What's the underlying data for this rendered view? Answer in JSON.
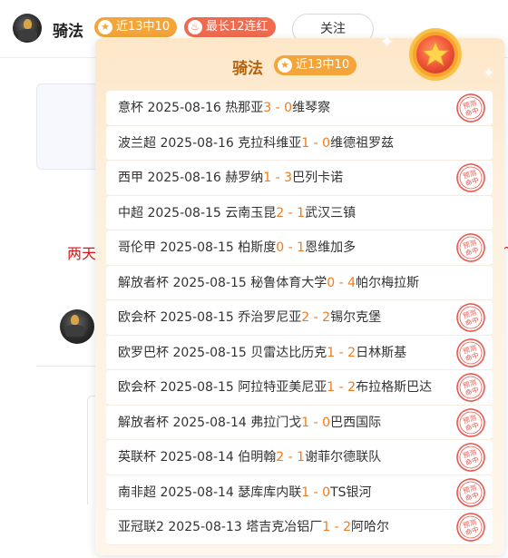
{
  "header": {
    "username": "骑法",
    "streak_badge": "近13中10",
    "max_badge": "最长12连红",
    "follow_label": "关注"
  },
  "background": {
    "text_left": "两天",
    "text_right": "h"
  },
  "popup": {
    "title": "骑法",
    "badge": "近13中10",
    "stamp_text": "预测命中",
    "matches": [
      {
        "league": "意杯",
        "date": "2025-08-16",
        "home": "热那亚",
        "home_score": "3",
        "away_score": "0",
        "away": "维琴察",
        "hit": true
      },
      {
        "league": "波兰超",
        "date": "2025-08-16",
        "home": "克拉科维亚",
        "home_score": "1",
        "away_score": "0",
        "away": "维德祖罗兹",
        "hit": false
      },
      {
        "league": "西甲",
        "date": "2025-08-16",
        "home": "赫罗纳",
        "home_score": "1",
        "away_score": "3",
        "away": "巴列卡诺",
        "hit": true
      },
      {
        "league": "中超",
        "date": "2025-08-15",
        "home": "云南玉昆",
        "home_score": "2",
        "away_score": "1",
        "away": "武汉三镇",
        "hit": false
      },
      {
        "league": "哥伦甲",
        "date": "2025-08-15",
        "home": "柏斯度",
        "home_score": "0",
        "away_score": "1",
        "away": "恩维加多",
        "hit": true
      },
      {
        "league": "解放者杯",
        "date": "2025-08-15",
        "home": "秘鲁体育大学",
        "home_score": "0",
        "away_score": "4",
        "away": "帕尔梅拉斯",
        "hit": false
      },
      {
        "league": "欧会杯",
        "date": "2025-08-15",
        "home": "乔治罗尼亚",
        "home_score": "2",
        "away_score": "2",
        "away": "锡尔克堡",
        "hit": true
      },
      {
        "league": "欧罗巴杯",
        "date": "2025-08-15",
        "home": "贝雷达比历克",
        "home_score": "1",
        "away_score": "2",
        "away": "日林斯基",
        "hit": true
      },
      {
        "league": "欧会杯",
        "date": "2025-08-15",
        "home": "阿拉特亚美尼亚",
        "home_score": "1",
        "away_score": "2",
        "away": "布拉格斯巴达",
        "hit": true
      },
      {
        "league": "解放者杯",
        "date": "2025-08-14",
        "home": "弗拉门戈",
        "home_score": "1",
        "away_score": "0",
        "away": "巴西国际",
        "hit": true
      },
      {
        "league": "英联杯",
        "date": "2025-08-14",
        "home": "伯明翰",
        "home_score": "2",
        "away_score": "1",
        "away": "谢菲尔德联队",
        "hit": true
      },
      {
        "league": "南非超",
        "date": "2025-08-14",
        "home": "瑟库库内联",
        "home_score": "1",
        "away_score": "0",
        "away": "TS银河",
        "hit": true
      },
      {
        "league": "亚冠联2",
        "date": "2025-08-13",
        "home": "塔吉克冶铝厂",
        "home_score": "1",
        "away_score": "2",
        "away": "阿哈尔",
        "hit": true
      }
    ]
  },
  "colors": {
    "accent_orange": "#f3a53a",
    "accent_red": "#f06a4f",
    "score_orange": "#f07a1e",
    "stamp_red": "#e8584f"
  }
}
